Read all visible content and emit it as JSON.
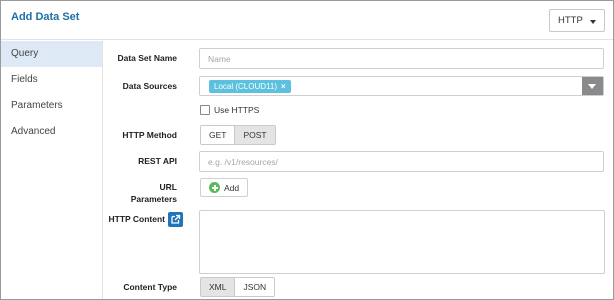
{
  "dialog": {
    "title": "Add Data Set",
    "type_value": "HTTP"
  },
  "sidebar": {
    "items": [
      "Query",
      "Fields",
      "Parameters",
      "Advanced"
    ]
  },
  "form": {
    "data_set_name": {
      "label": "Data Set Name",
      "placeholder": "Name"
    },
    "data_sources": {
      "label": "Data Sources",
      "chip": "Local (CLOUD11)",
      "chip_remove": "×"
    },
    "use_https": {
      "label": "Use HTTPS",
      "checked": false
    },
    "http_method": {
      "label": "HTTP Method",
      "options": [
        "GET",
        "POST"
      ],
      "selected": "POST"
    },
    "rest_api": {
      "label": "REST API",
      "placeholder": "e.g. /v1/resources/"
    },
    "url_parameters": {
      "label_line1": "URL",
      "label_line2": "Parameters",
      "add_label": "Add"
    },
    "http_content": {
      "label": "HTTP Content"
    },
    "content_type": {
      "label": "Content Type",
      "options": [
        "XML",
        "JSON"
      ],
      "selected": "XML"
    }
  },
  "colors": {
    "title": "#1e6fa8",
    "active_sidebar": "#dde9f5",
    "chip": "#5bc1de",
    "add_icon": "#5cb85c",
    "external_icon": "#1f75b8"
  }
}
